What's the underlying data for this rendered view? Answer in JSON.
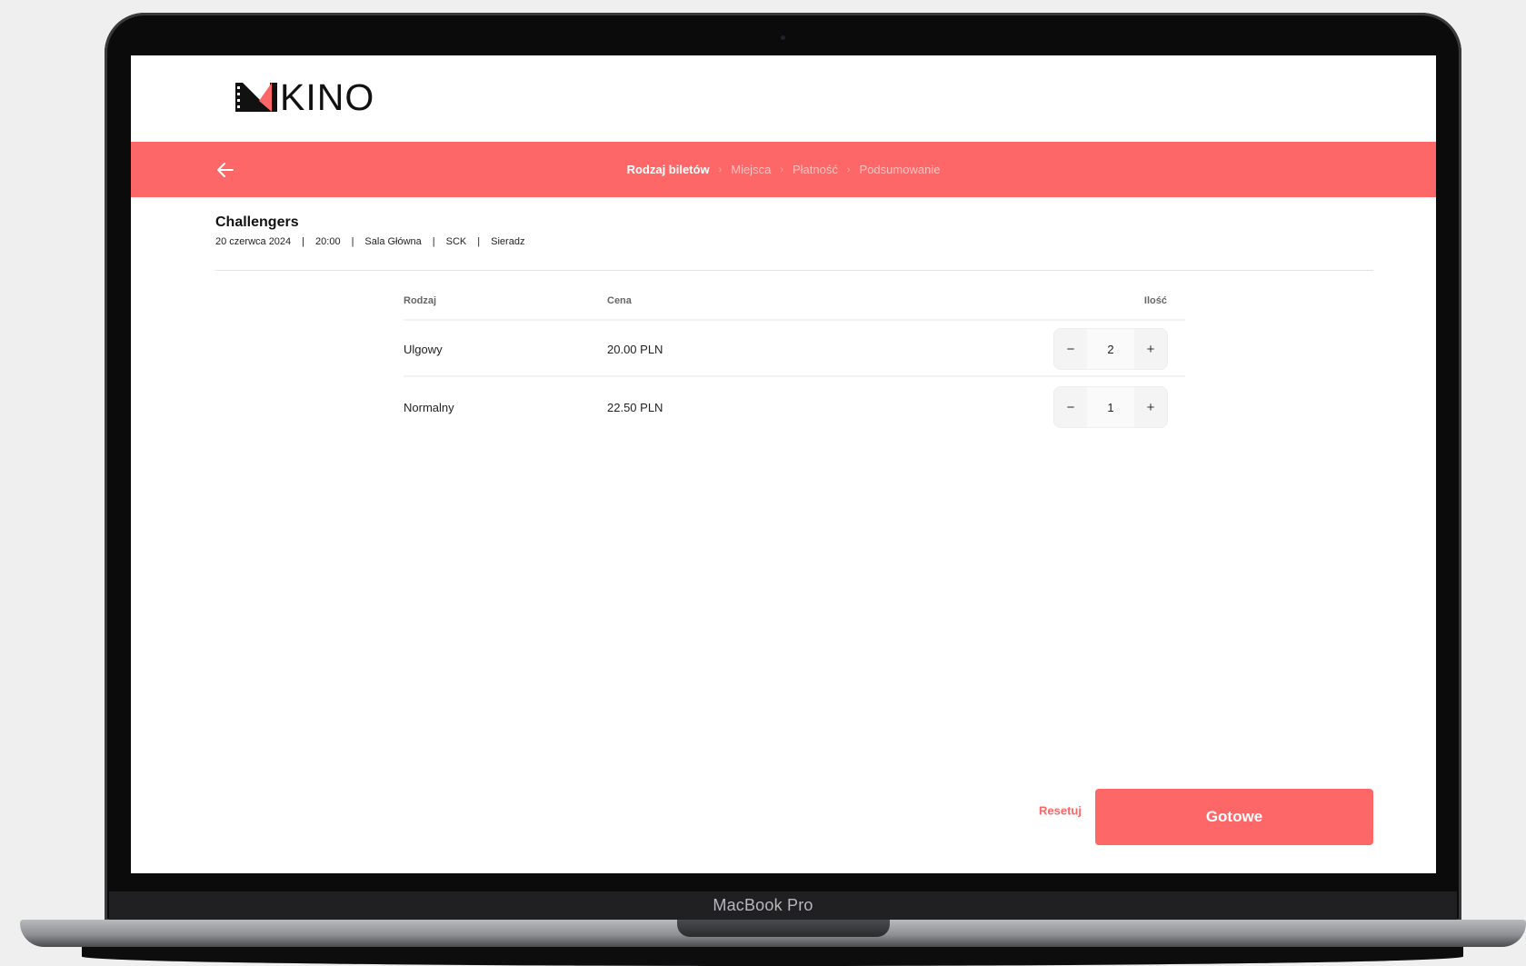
{
  "app": {
    "logo_text": "KINO"
  },
  "stepbar": {
    "steps": [
      {
        "label": "Rodzaj biletów",
        "active": true
      },
      {
        "label": "Miejsca",
        "active": false
      },
      {
        "label": "Płatność",
        "active": false
      },
      {
        "label": "Podsumowanie",
        "active": false
      }
    ],
    "separator": "›"
  },
  "movie": {
    "title": "Challengers",
    "date": "20 czerwca 2024",
    "time": "20:00",
    "hall": "Sala Główna",
    "venue": "SCK",
    "city": "Sieradz",
    "separator": "|"
  },
  "tickets_table": {
    "headers": {
      "type": "Rodzaj",
      "price": "Cena",
      "qty": "Ilość"
    },
    "rows": [
      {
        "type": "Ulgowy",
        "price": "20.00 PLN",
        "qty": "2"
      },
      {
        "type": "Normalny",
        "price": "22.50 PLN",
        "qty": "1"
      }
    ],
    "minus_label": "−",
    "plus_label": "+"
  },
  "actions": {
    "reset_label": "Resetuj",
    "done_label": "Gotowe"
  },
  "device": {
    "label": "MacBook Pro"
  },
  "colors": {
    "accent": "#fe6767",
    "text": "#111111"
  },
  "icons": {
    "back": "arrow-left-icon",
    "logo": "kino-logo-icon"
  }
}
